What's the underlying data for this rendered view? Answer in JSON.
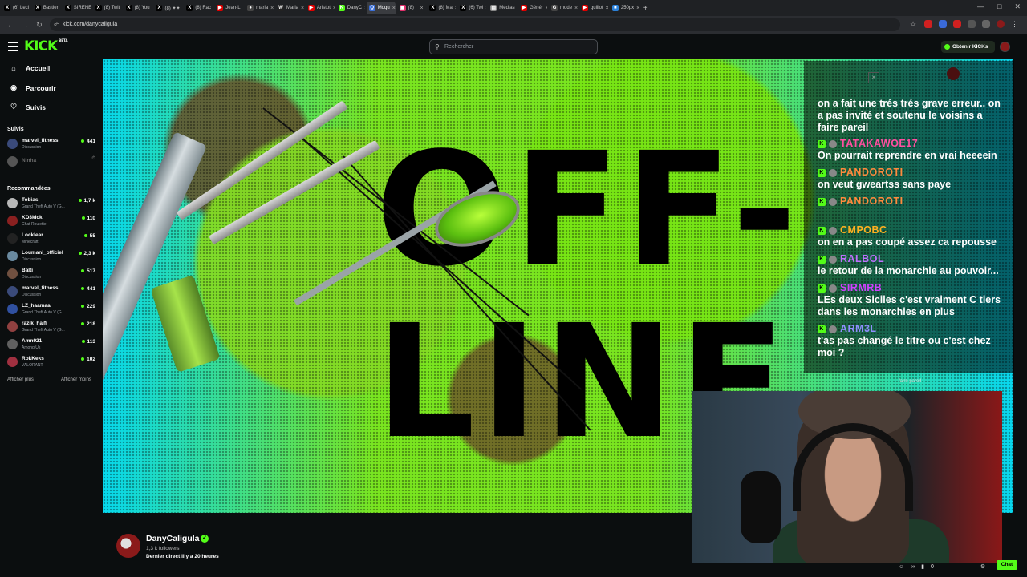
{
  "browser": {
    "tabs": [
      {
        "label": "(6) Leci",
        "color": "#000",
        "glyph": "X"
      },
      {
        "label": "Bastien",
        "color": "#000",
        "glyph": "X"
      },
      {
        "label": "SIRENE",
        "color": "#000",
        "glyph": "X"
      },
      {
        "label": "(8) Twit",
        "color": "#000",
        "glyph": "X"
      },
      {
        "label": "(8) You",
        "color": "#000",
        "glyph": "X"
      },
      {
        "label": "(8) ✦✦",
        "color": "#000",
        "glyph": "X"
      },
      {
        "label": "(8) Rac",
        "color": "#000",
        "glyph": "X"
      },
      {
        "label": "Jean-L",
        "color": "#e00000",
        "glyph": "▶"
      },
      {
        "label": "maria",
        "color": "#444",
        "glyph": "●"
      },
      {
        "label": "Maria",
        "color": "#222",
        "glyph": "W"
      },
      {
        "label": "Aristot",
        "color": "#e00000",
        "glyph": "▶"
      },
      {
        "label": "DanyC",
        "color": "#53fc18",
        "glyph": "K"
      },
      {
        "label": "Moqu",
        "color": "#3b6fd8",
        "glyph": "Q",
        "active": true
      },
      {
        "label": "(8)",
        "color": "#e1306c",
        "glyph": "▣"
      },
      {
        "label": "(8) Ma",
        "color": "#000",
        "glyph": "X"
      },
      {
        "label": "(6) Twi",
        "color": "#000",
        "glyph": "X"
      },
      {
        "label": "Médias",
        "color": "#888",
        "glyph": "▤"
      },
      {
        "label": "Génér",
        "color": "#e00000",
        "glyph": "▶"
      },
      {
        "label": "mode",
        "color": "#444",
        "glyph": "G"
      },
      {
        "label": "guillot",
        "color": "#e00000",
        "glyph": "▶"
      },
      {
        "label": "250px",
        "color": "#2b80d8",
        "glyph": "■"
      }
    ],
    "new_tab": "+",
    "url": "kick.com/danycaligula",
    "win_min": "—",
    "win_max": "□",
    "win_close": "✕"
  },
  "header": {
    "logo": "KICK",
    "logo_sup": "BETA",
    "search_placeholder": "Rechercher",
    "kicks_button": "Obtenir KICKs"
  },
  "sidebar": {
    "nav": [
      {
        "label": "Accueil",
        "icon": "home-icon",
        "glyph": "⌂"
      },
      {
        "label": "Parcourir",
        "icon": "compass-icon",
        "glyph": "◉"
      },
      {
        "label": "Suivis",
        "icon": "heart-icon",
        "glyph": "♡"
      }
    ],
    "followed_title": "Suivis",
    "followed": [
      {
        "name": "marvel_fitness",
        "category": "Discussion",
        "viewers": "441",
        "avatar": "#3a4a7a"
      },
      {
        "name": "Ninha",
        "category": "",
        "viewers": "⏱",
        "avatar": "#555",
        "offline": true
      }
    ],
    "recommended_title": "Recommandées",
    "recommended": [
      {
        "name": "Tobias",
        "category": "Grand Theft Auto V (G...",
        "viewers": "1,7 k",
        "avatar": "#b8b8b8"
      },
      {
        "name": "KD3kick",
        "category": "Chat Roulette",
        "viewers": "110",
        "avatar": "#8a2020"
      },
      {
        "name": "Locklear",
        "category": "Minecraft",
        "viewers": "55",
        "avatar": "#222"
      },
      {
        "name": "Loumani_officiel",
        "category": "Discussion",
        "viewers": "2,3 k",
        "avatar": "#6a8aa0"
      },
      {
        "name": "Balti",
        "category": "Discussion",
        "viewers": "517",
        "avatar": "#705040"
      },
      {
        "name": "marvel_fitness",
        "category": "Discussion",
        "viewers": "441",
        "avatar": "#3a4a7a"
      },
      {
        "name": "LZ_haamaa",
        "category": "Grand Theft Auto V (G...",
        "viewers": "229",
        "avatar": "#3050a0"
      },
      {
        "name": "razik_haifi",
        "category": "Grand Theft Auto V (G...",
        "viewers": "218",
        "avatar": "#904040"
      },
      {
        "name": "Amn921",
        "category": "Among Us",
        "viewers": "113",
        "avatar": "#606060"
      },
      {
        "name": "RokKeks",
        "category": "VALORANT",
        "viewers": "102",
        "avatar": "#a03040"
      }
    ],
    "show_more": "Afficher plus",
    "show_less": "Afficher moins"
  },
  "player": {
    "offline_line1": "OFF-",
    "offline_line2": "LINE"
  },
  "chat": {
    "messages": [
      {
        "user": "",
        "text": "on a fait une trés trés grave erreur.. on a pas invité et soutenu le voisins a faire pareil",
        "color": "#53fc18"
      },
      {
        "user": "TATAKAWOE17",
        "text": "On pourrait reprendre en vrai heeeein",
        "color": "#ff4fa0"
      },
      {
        "user": "PANDOROTI",
        "text": "on veut gweartss sans paye",
        "color": "#ff8a3d"
      },
      {
        "user": "PANDOROTI",
        "text": "",
        "color": "#ff8a3d"
      },
      {
        "user": "CMPOBC",
        "text": "on en a pas coupé assez ca repousse",
        "color": "#ffb020"
      },
      {
        "user": "RALBOL",
        "text": "le retour de la monarchie au pouvoir...",
        "color": "#c070ff"
      },
      {
        "user": "SIRMRB",
        "text": "LEs deux Siciles c'est vraiment C tiers dans les monarchies en plus",
        "color": "#d040ff"
      },
      {
        "user": "ARM3L",
        "text": "t'as pas changé le titre ou c'est chez moi ?",
        "color": "#9090ff"
      }
    ],
    "ghost_text": "faire pareil",
    "close": "×"
  },
  "stream": {
    "name": "DanyCaligula",
    "verified": "✓",
    "followers": "1,3 k followers",
    "last_live": "Dernier direct il y a 20 heures"
  },
  "footer": {
    "viewers_count": "0",
    "chat_button": "Chat"
  }
}
